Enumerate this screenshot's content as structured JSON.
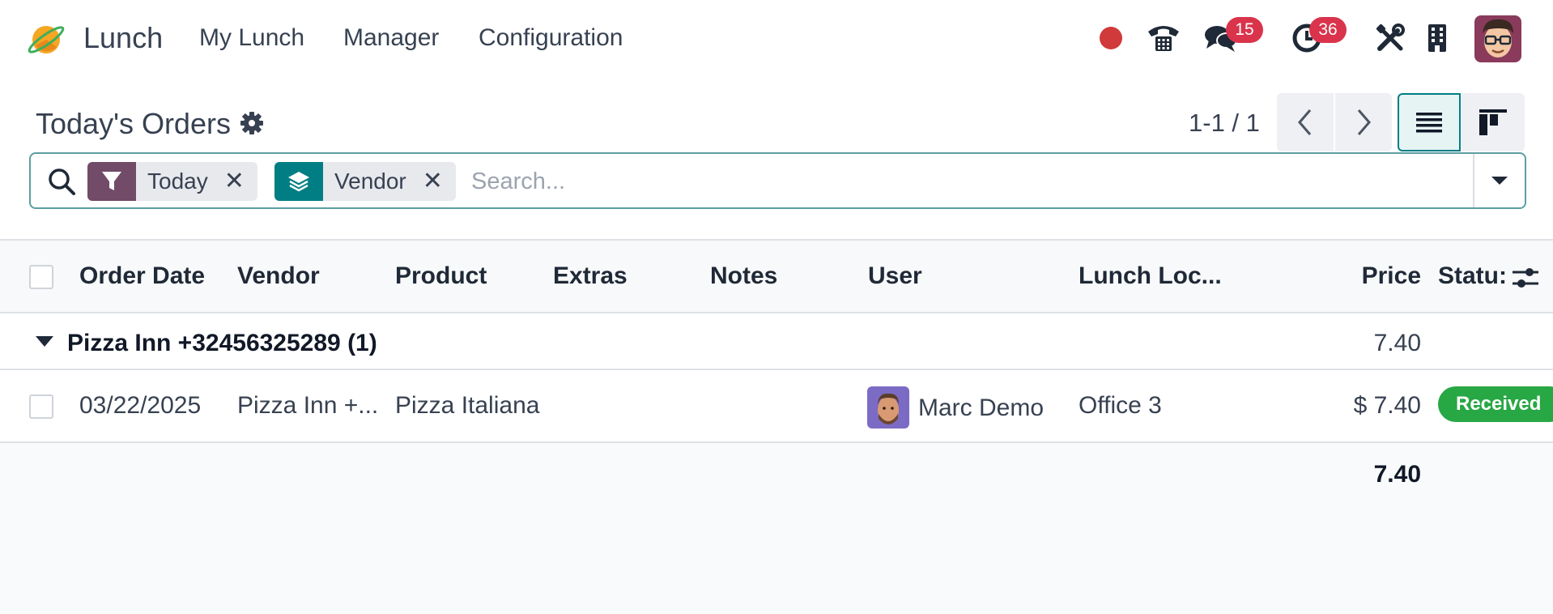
{
  "navbar": {
    "app_name": "Lunch",
    "menu": [
      "My Lunch",
      "Manager",
      "Configuration"
    ],
    "status_dot_color": "#d13a3a",
    "messages_badge": "15",
    "activities_badge": "36",
    "icons": [
      "phone-icon",
      "chat-icon",
      "clock-icon",
      "tools-icon",
      "building-icon"
    ]
  },
  "control_panel": {
    "title": "Today's Orders",
    "pager": "1-1 / 1"
  },
  "search": {
    "facets": [
      {
        "label": "Today",
        "icon": "filter-icon",
        "color": "#714b67"
      },
      {
        "label": "Vendor",
        "icon": "layers-icon",
        "color": "#017e84"
      }
    ],
    "placeholder": "Search..."
  },
  "list": {
    "columns": [
      "Order Date",
      "Vendor",
      "Product",
      "Extras",
      "Notes",
      "User",
      "Lunch Loc...",
      "Price",
      "Statu:"
    ],
    "group": {
      "label": "Pizza Inn +32456325289 (1)",
      "sum": "7.40"
    },
    "rows": [
      {
        "order_date": "03/22/2025",
        "vendor": "Pizza Inn +...",
        "product": "Pizza Italiana",
        "extras": "",
        "notes": "",
        "user": "Marc Demo",
        "location": "Office 3",
        "price": "$ 7.40",
        "status": "Received",
        "status_color": "#28a745"
      }
    ],
    "total": "7.40"
  }
}
